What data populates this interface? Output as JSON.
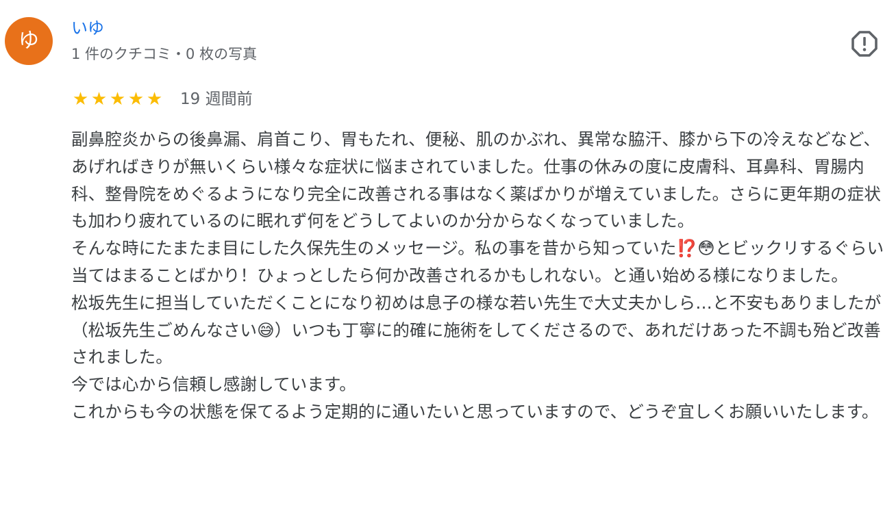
{
  "review": {
    "avatar_letter": "ゆ",
    "author_name": "いゆ",
    "author_stats": "1 件のクチコミ・0 枚の写真",
    "report_icon": "report-flag-icon",
    "rating": 5,
    "stars": [
      "★",
      "★",
      "★",
      "★",
      "★"
    ],
    "time": "19 週間前",
    "paragraphs": [
      "副鼻腔炎からの後鼻漏、肩首こり、胃もたれ、便秘、肌のかぶれ、異常な脇汗、膝から下の冷えなどなど、あげればきりが無いくらい様々な症状に悩まされていました。仕事の休みの度に皮膚科、耳鼻科、胃腸内科、整骨院をめぐるようになり完全に改善される事はなく薬ばかりが増えていました。さらに更年期の症状も加わり疲れているのに眠れず何をどうしてよいのか分からなくなっていました。",
      "そんな時にたまたま目にした久保先生のメッセージ。私の事を昔から知っていた⁉️😳とビックリするぐらい当てはまることばかり！ひょっとしたら何か改善されるかもしれない。と通い始める様になりました。",
      "松坂先生に担当していただくことになり初めは息子の様な若い先生で大丈夫かしら…と不安もありましたが（松坂先生ごめんなさい😅）いつも丁寧に的確に施術をしてくださるので、あれだけあった不調も殆ど改善されました。",
      "今では心から信頼し感謝しています。",
      "これからも今の状態を保てるよう定期的に通いたいと思っていますので、どうぞ宜しくお願いいたします。"
    ]
  },
  "colors": {
    "avatar_bg": "#e8711a",
    "author_link": "#1a73e8",
    "star": "#fbbc04",
    "secondary_text": "#5f6368",
    "body_text": "#3c4043"
  }
}
